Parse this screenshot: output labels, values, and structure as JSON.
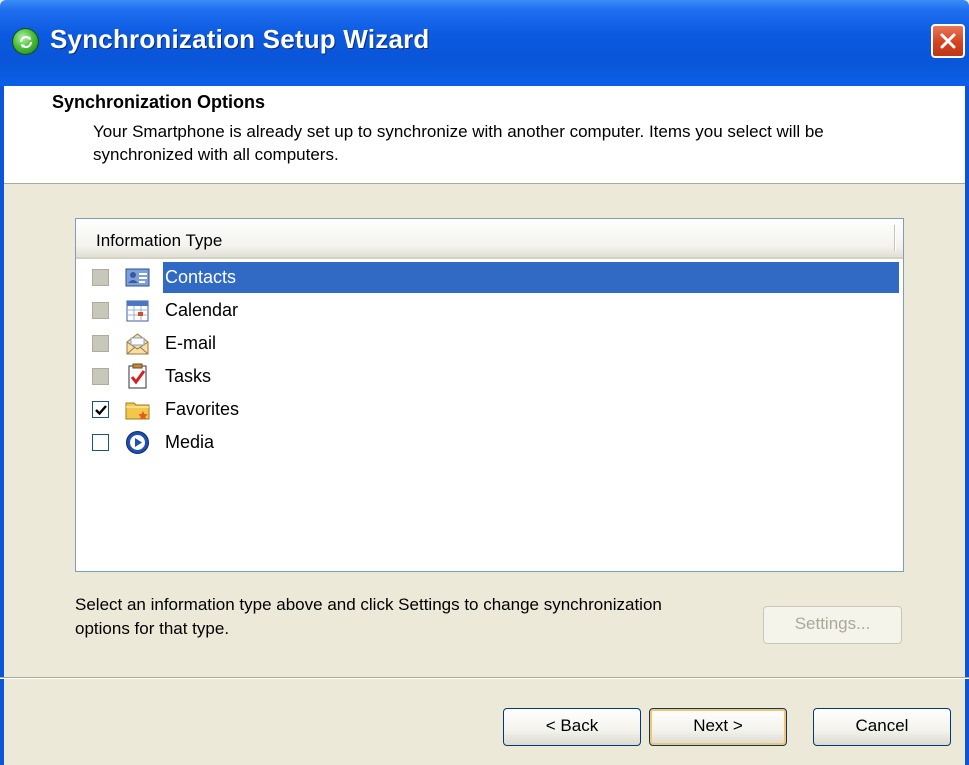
{
  "window": {
    "title": "Synchronization Setup Wizard",
    "title_bar_color": "#0a55d8",
    "close_color": "#d3431f"
  },
  "header": {
    "heading": "Synchronization Options",
    "description": "Your Smartphone is already set up to synchronize with another computer. Items you select will be synchronized with all computers."
  },
  "list": {
    "column_header": "Information Type",
    "selection_color": "#316ac5",
    "items": [
      {
        "label": "Contacts",
        "checked": false,
        "enabled": false,
        "selected": true,
        "icon": "contact-card-icon"
      },
      {
        "label": "Calendar",
        "checked": false,
        "enabled": false,
        "selected": false,
        "icon": "calendar-icon"
      },
      {
        "label": "E-mail",
        "checked": false,
        "enabled": false,
        "selected": false,
        "icon": "email-envelope-icon"
      },
      {
        "label": "Tasks",
        "checked": false,
        "enabled": false,
        "selected": false,
        "icon": "tasks-clipboard-icon"
      },
      {
        "label": "Favorites",
        "checked": true,
        "enabled": true,
        "selected": false,
        "icon": "favorites-folder-icon"
      },
      {
        "label": "Media",
        "checked": false,
        "enabled": true,
        "selected": false,
        "icon": "media-player-icon"
      }
    ]
  },
  "info": {
    "text": "Select an information type above and click Settings to change synchronization options for that type."
  },
  "buttons": {
    "settings": "Settings...",
    "back": "< Back",
    "next": "Next >",
    "cancel": "Cancel"
  }
}
